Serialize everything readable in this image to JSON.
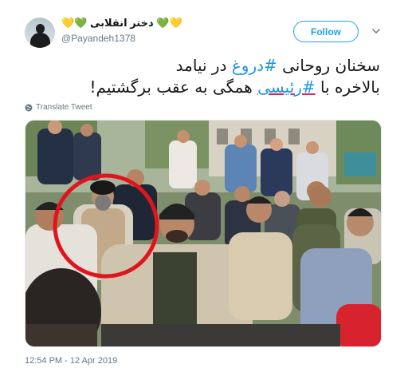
{
  "header": {
    "display_name": "دختر انقلابی",
    "emoji_left": "💛💚",
    "emoji_right": "💚💛",
    "handle": "@Payandeh1378",
    "follow_label": "Follow",
    "chevron_icon": "chevron-down-icon",
    "avatar_icon": "avatar"
  },
  "tweet": {
    "line1_pre": "سخنان روحانی ",
    "line1_hashtag": "#دروغ",
    "line1_post": " در نیامد",
    "line2_pre": "بالاخره با ",
    "line2_hashtag": "#رئیسی",
    "line2_post": " همگی به عقب برگشتیم!",
    "translate_label": "Translate Tweet"
  },
  "photo": {
    "highlight_color": "#e0141e",
    "alt_description": ""
  },
  "footer": {
    "timestamp": "12:54 PM - 12 Apr 2019"
  },
  "colors": {
    "accent": "#1da1f2",
    "hashtag": "#1b95e0",
    "muted": "#657786"
  }
}
